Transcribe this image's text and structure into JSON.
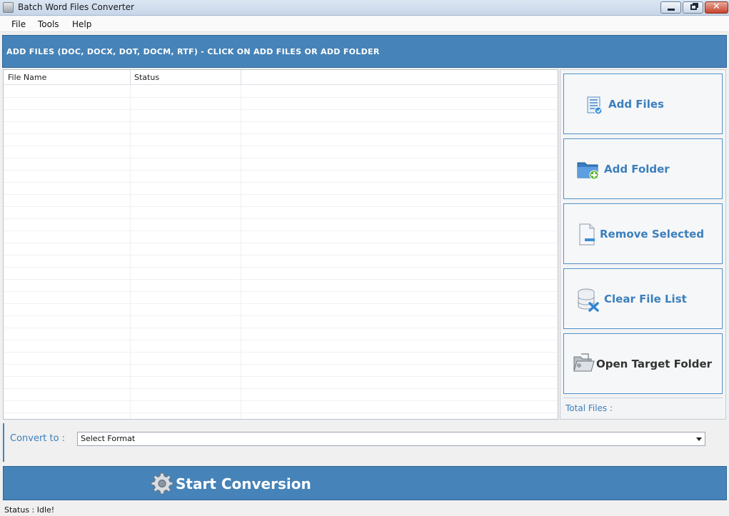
{
  "window": {
    "title": "Batch Word Files Converter",
    "close_glyph": "✕"
  },
  "menu": {
    "items": [
      {
        "label": "File"
      },
      {
        "label": "Tools"
      },
      {
        "label": "Help"
      }
    ]
  },
  "header": {
    "instruction": "ADD FILES (DOC, DOCX, DOT, DOCM, RTF) - CLICK ON ADD FILES OR ADD FOLDER"
  },
  "file_list": {
    "columns": [
      "File Name",
      "Status"
    ],
    "rows": []
  },
  "actions": {
    "add_files": "Add Files",
    "add_folder": "Add Folder",
    "remove_selected": "Remove Selected",
    "clear_file_list": "Clear File List",
    "open_target_folder": "Open Target Folder",
    "total_files_label": "Total Files :"
  },
  "convert": {
    "label": "Convert to :",
    "selected_format": "Select Format"
  },
  "start": {
    "label": "Start Conversion"
  },
  "status": {
    "text": "Status  :  Idle!"
  },
  "colors": {
    "accent": "#4683b8",
    "link_text": "#3b7fbd",
    "close_button": "#c7432c"
  },
  "icons": {
    "app": "app-icon",
    "add_files": "file-list-add-icon",
    "add_folder": "folder-add-icon",
    "remove": "file-remove-icon",
    "clear": "database-clear-icon",
    "open_folder": "open-folder-icon",
    "start": "gear-icon"
  }
}
